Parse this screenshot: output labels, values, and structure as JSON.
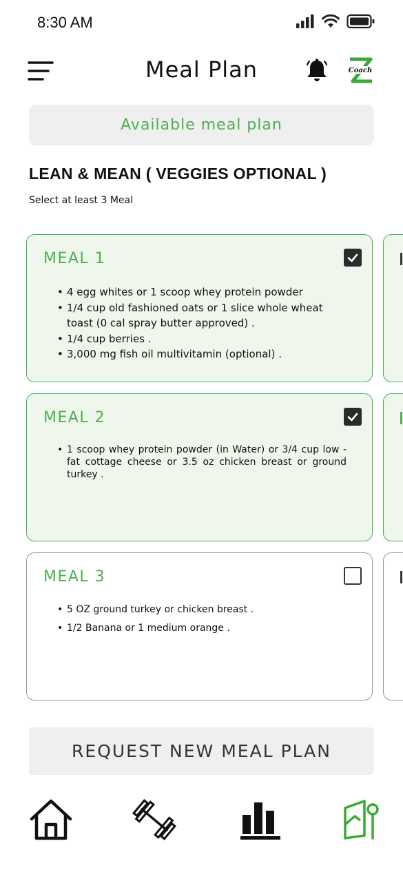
{
  "status_bar": {
    "time": "8:30 AM"
  },
  "header": {
    "title": "Meal Plan",
    "menu_icon": "hamburger-menu-icon",
    "notification_icon": "bell-icon",
    "logo_text": "Coach"
  },
  "tab": {
    "label": "Available meal plan"
  },
  "plan": {
    "title": "LEAN & MEAN ( VEGGIES OPTIONAL )",
    "subtitle": "Select at least 3 Meal"
  },
  "meals": [
    {
      "title": "MEAL 1",
      "checked": true,
      "items": [
        "4 egg whites or 1 scoop whey protein powder",
        "1/4 cup old fashioned oats or 1 slice whole wheat toast (0 cal spray butter approved) .",
        "1/4 cup berries .",
        "3,000 mg fish oil multivitamin (optional) ."
      ]
    },
    {
      "title": "MEAL 2",
      "checked": true,
      "items": [
        "1 scoop whey protein powder (in Water) or 3/4 cup low - fat cottage cheese or 3.5 oz chicken breast or ground turkey ."
      ]
    },
    {
      "title": "MEAL 3",
      "checked": false,
      "items": [
        "5 OZ ground turkey or chicken breast .",
        "1/2 Banana or 1 medium orange ."
      ]
    }
  ],
  "request_button": {
    "label": "REQUEST NEW MEAL PLAN"
  },
  "bottom_nav": {
    "items": [
      "home-icon",
      "dumbbell-icon",
      "bar-chart-icon",
      "meal-plan-icon"
    ],
    "active": "meal-plan-icon"
  },
  "colors": {
    "accent": "#4caf50",
    "card_selected_bg": "#eff7ec",
    "button_bg": "#efefef",
    "text": "#111111"
  }
}
